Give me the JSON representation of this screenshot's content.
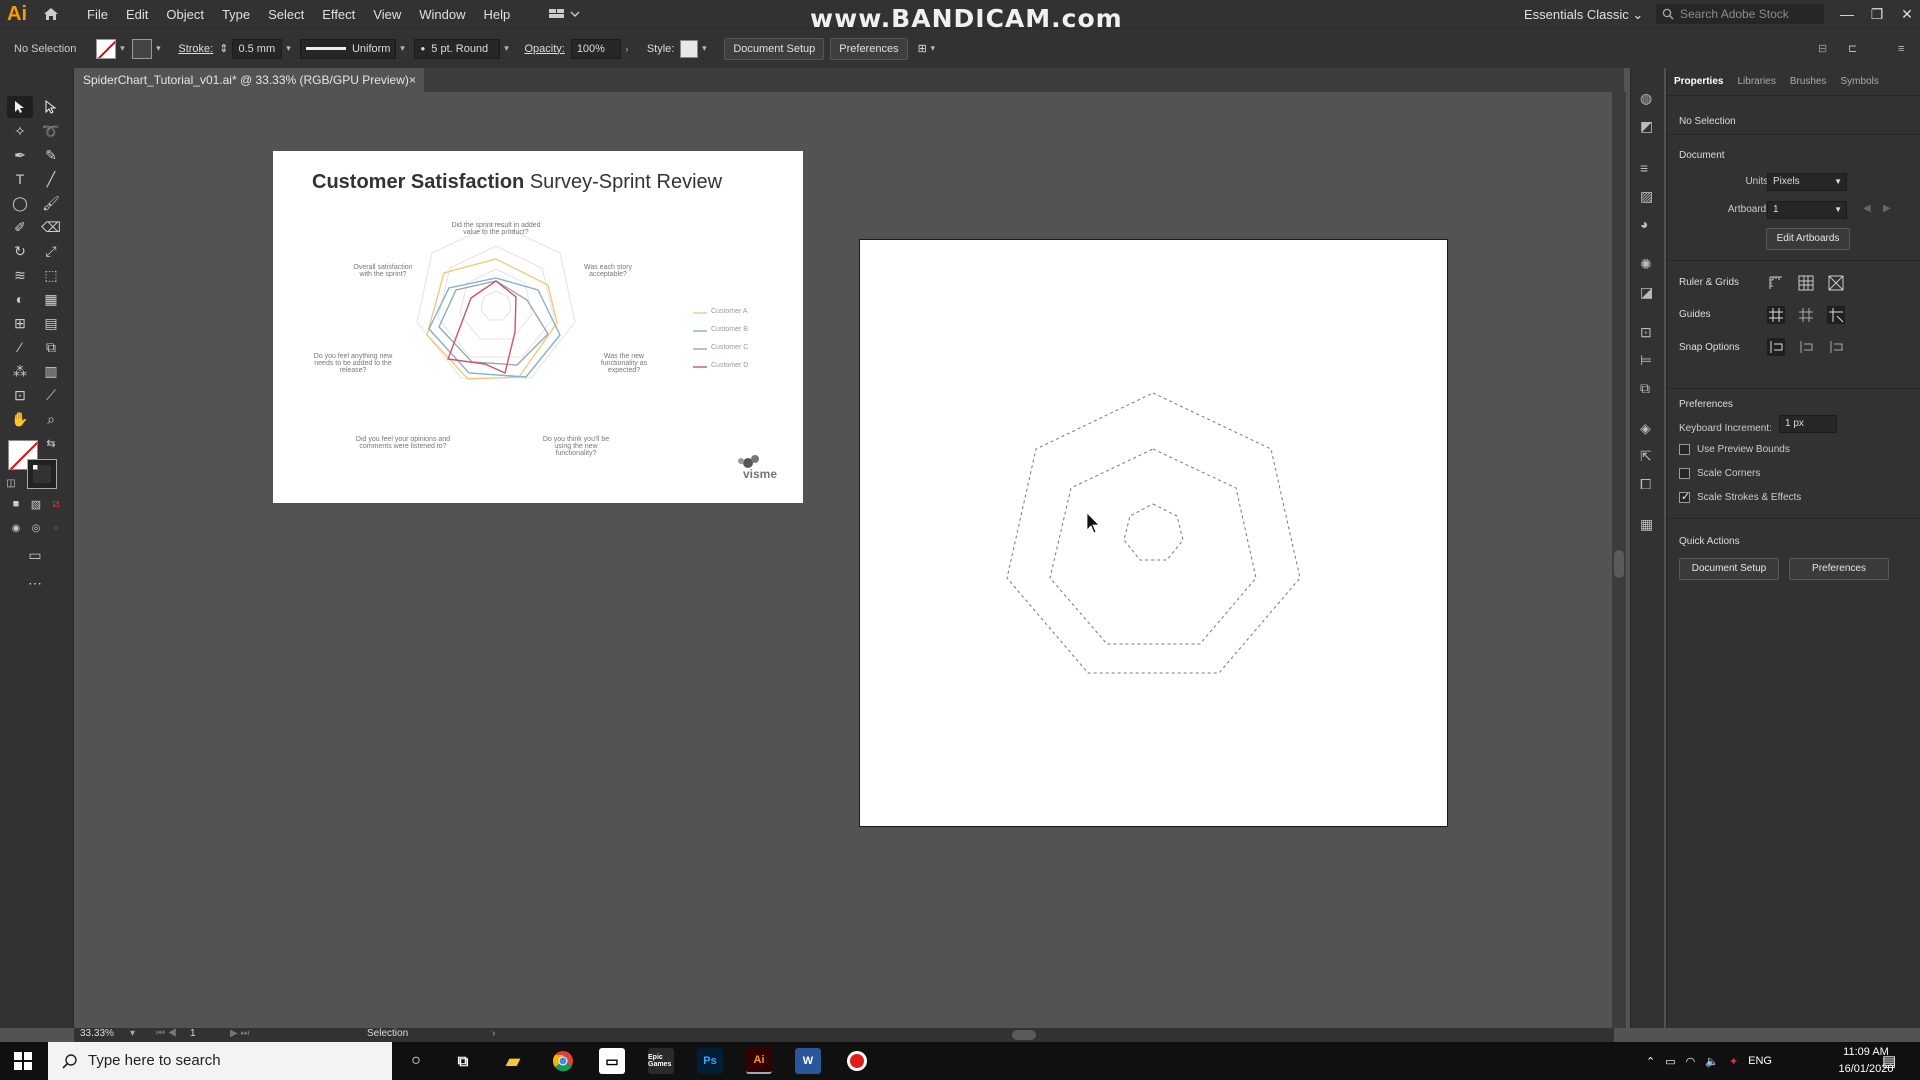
{
  "app": {
    "logo": "Ai",
    "menu": [
      "File",
      "Edit",
      "Object",
      "Type",
      "Select",
      "Effect",
      "View",
      "Window",
      "Help"
    ],
    "watermark": "www.BANDICAM.com",
    "workspace": "Essentials Classic",
    "stock_placeholder": "Search Adobe Stock"
  },
  "control": {
    "selection": "No Selection",
    "stroke_label": "Stroke:",
    "stroke_value": "0.5 mm",
    "profile": "Uniform",
    "brush": "5 pt. Round",
    "opacity_label": "Opacity:",
    "opacity_value": "100%",
    "style_label": "Style:",
    "doc_setup": "Document Setup",
    "preferences": "Preferences"
  },
  "document": {
    "tab_title": "SpiderChart_Tutorial_v01.ai* @ 33.33% (RGB/GPU Preview)",
    "close": "×"
  },
  "reference": {
    "title_bold": "Customer Satisfaction",
    "title_rest": " Survey-Sprint Review",
    "labels": [
      "Did the sprint result in added value to the product?",
      "Was each story acceptable?",
      "Was the new functionality as expected?",
      "Do you think you'll be using the new functionality?",
      "Did you feel your opinions and comments were listened to?",
      "Do you feel anything new needs to be added to the release?",
      "Overall satisfaction with the sprint?"
    ],
    "legend": [
      {
        "name": "Customer A",
        "color": "#f2c97b"
      },
      {
        "name": "Customer B",
        "color": "#7fb2d6"
      },
      {
        "name": "Customer C",
        "color": "#9aa7b2"
      },
      {
        "name": "Customer D",
        "color": "#c9566a"
      }
    ],
    "brand": "visme"
  },
  "panel": {
    "tabs": [
      "Properties",
      "Libraries",
      "Brushes",
      "Symbols"
    ],
    "no_selection": "No Selection",
    "document": "Document",
    "units_label": "Units:",
    "units_value": "Pixels",
    "artboard_label": "Artboard:",
    "artboard_value": "1",
    "edit_artboards": "Edit Artboards",
    "ruler_grids": "Ruler & Grids",
    "guides": "Guides",
    "snap_options": "Snap Options",
    "preferences": "Preferences",
    "keyboard_increment_label": "Keyboard Increment:",
    "keyboard_increment_value": "1 px",
    "use_preview_bounds": "Use Preview Bounds",
    "scale_corners": "Scale Corners",
    "scale_strokes": "Scale Strokes & Effects",
    "quick_actions": "Quick Actions",
    "qa_doc_setup": "Document Setup",
    "qa_preferences": "Preferences"
  },
  "status": {
    "zoom": "33.33%",
    "artboard_num": "1",
    "tool": "Selection"
  },
  "taskbar": {
    "search": "Type here to search",
    "lang": "ENG",
    "time": "11:09 AM",
    "date": "16/01/2020",
    "apps": [
      "Epic Games",
      "Ps",
      "Ai",
      "W"
    ]
  }
}
